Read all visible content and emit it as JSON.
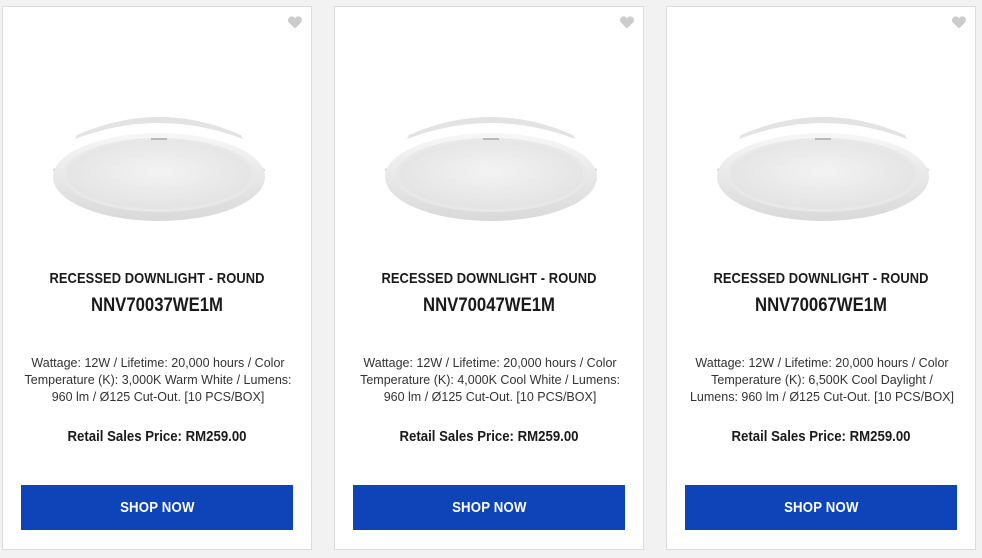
{
  "colors": {
    "accent": "#0e44b8",
    "favorite_icon": "#cccccc",
    "card_border": "#dcdcdc"
  },
  "products": [
    {
      "type": "RECESSED DOWNLIGHT - ROUND",
      "model": "NNV70037WE1M",
      "description": "Wattage: 12W / Lifetime: 20,000 hours / Color Temperature (K): 3,000K Warm White / Lumens: 960 lm / Ø125 Cut-Out. [10 PCS/BOX]",
      "price": "Retail Sales Price: RM259.00",
      "button": "SHOP NOW",
      "favorite_icon": "heart-icon"
    },
    {
      "type": "RECESSED DOWNLIGHT - ROUND",
      "model": "NNV70047WE1M",
      "description": "Wattage: 12W / Lifetime: 20,000 hours / Color Temperature (K): 4,000K Cool White / Lumens: 960 lm / Ø125 Cut-Out. [10 PCS/BOX]",
      "price": "Retail Sales Price: RM259.00",
      "button": "SHOP NOW",
      "favorite_icon": "heart-icon"
    },
    {
      "type": "RECESSED DOWNLIGHT - ROUND",
      "model": "NNV70067WE1M",
      "description": "Wattage: 12W / Lifetime: 20,000 hours / Color Temperature (K): 6,500K Cool Daylight / Lumens: 960 lm / Ø125 Cut-Out. [10 PCS/BOX]",
      "price": "Retail Sales Price: RM259.00",
      "button": "SHOP NOW",
      "favorite_icon": "heart-icon"
    }
  ]
}
